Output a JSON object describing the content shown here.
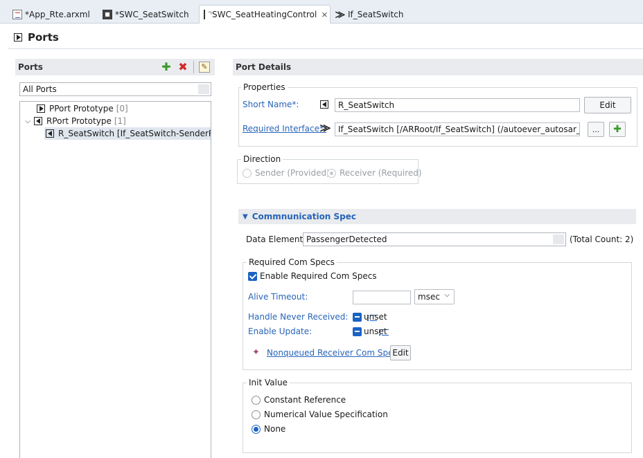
{
  "tabs": [
    {
      "label": "*App_Rte.arxml",
      "icon": "arxml-file-icon"
    },
    {
      "label": "*SWC_SeatSwitch",
      "icon": "swc-component-icon"
    },
    {
      "label": "*SWC_SeatHeatingControl",
      "icon": "swc-component-icon",
      "active": true
    },
    {
      "label": "If_SeatSwitch",
      "icon": "interface-icon"
    }
  ],
  "close_glyph": "⨯",
  "editor": {
    "title": "Ports"
  },
  "ports_panel": {
    "title": "Ports",
    "toolbar": {
      "add": "✚",
      "remove": "✖",
      "edit": "✎"
    },
    "filter_value": "All Ports",
    "tree": [
      {
        "label": "PPort Prototype",
        "count": "[0]"
      },
      {
        "label": "RPort Prototype",
        "count": "[1]"
      },
      {
        "label": "R_SeatSwitch [If_SeatSwitch-SenderReceiverInterface]"
      }
    ]
  },
  "details": {
    "title": "Port Details",
    "properties": {
      "legend": "Properties",
      "short_name_label": "Short Name*:",
      "short_name_value": "R_SeatSwitch",
      "edit_button": "Edit",
      "required_interface_label": "Required Interface*:",
      "required_interface_value": "If_SeatSwitch [/ARRoot/If_SeatSwitch] (/autoever_autosar_edu_WS/App/App_Rte.arxml)",
      "browse_button": "...",
      "add_button": "✚"
    },
    "direction": {
      "legend": "Direction",
      "options": [
        "Sender (Provided)",
        "Receiver (Required)"
      ],
      "selected": "Receiver (Required)"
    },
    "comm_spec": {
      "title": "Commnunication Spec",
      "data_elements_label": "Data Elements",
      "data_elements_value": "PassengerDetected",
      "total_count": "(Total Count: 2)",
      "required_com_specs": {
        "legend": "Required Com Specs",
        "enable_label": "Enable Required Com Specs",
        "alive_timeout_label": "Alive Timeout:",
        "alive_timeout_value": "",
        "unit_value": "msec",
        "handle_never_received_label": "Handle Never Received:",
        "handle_never_received_value": "unset",
        "enable_update_label": "Enable Update:",
        "enable_update_value": "unset",
        "nonqueued_link": "Nonqueued Receiver Com Spec",
        "edit_button": "Edit"
      },
      "init_value": {
        "legend": "Init Value",
        "options": [
          "Constant Reference",
          "Numerical Value Specification",
          "None"
        ],
        "selected": "None"
      }
    }
  }
}
